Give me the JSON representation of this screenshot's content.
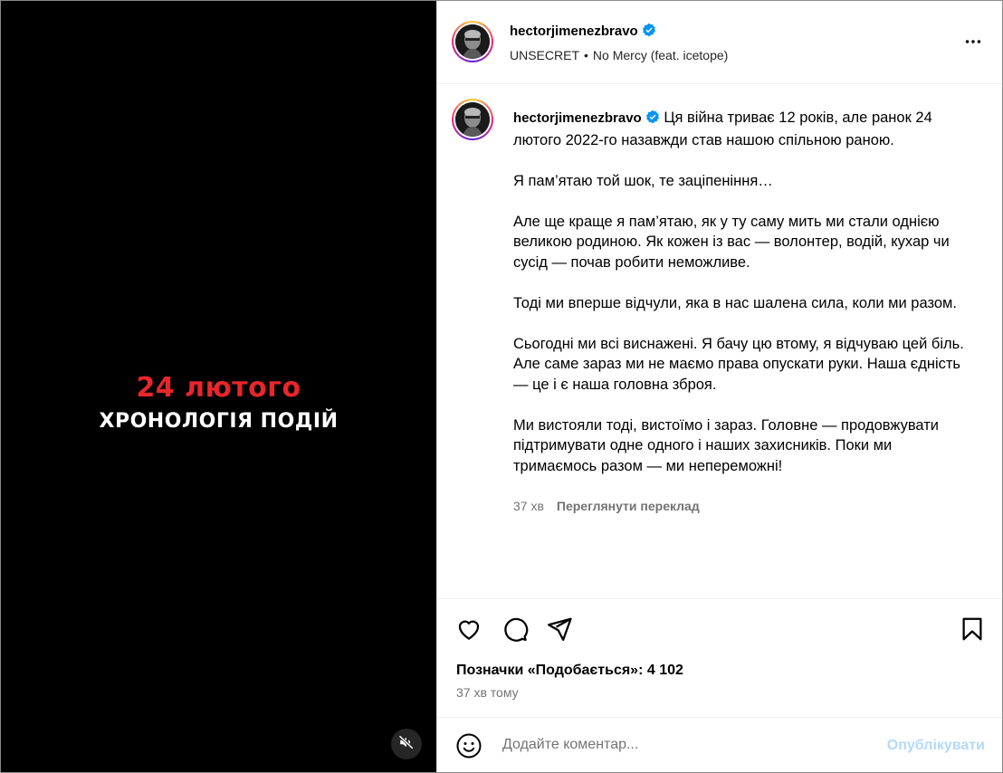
{
  "video": {
    "title_red": "24 лютого",
    "title_white": "ХРОНОЛОГІЯ ПОДІЙ"
  },
  "header": {
    "username": "hectorjimenezbravo",
    "audio_artist": "UNSECRET",
    "audio_sep": "•",
    "audio_track": "No Mercy (feat. icetope)"
  },
  "caption": {
    "username": "hectorjimenezbravo",
    "paragraphs": [
      "Ця війна триває 12 років, але ранок 24 лютого 2022-го назавжди став нашою спільною раною.",
      "Я пам’ятаю той шок, те заціпеніння…",
      "Але ще краще я пам’ятаю, як у ту саму мить ми стали однією великою родиною. Як кожен із вас — волонтер, водій, кухар чи сусід — почав робити неможливе.",
      "Тоді ми вперше відчули, яка в нас шалена сила, коли ми разом.",
      "Сьогодні ми всі виснажені. Я бачу цю втому, я відчуваю цей біль. Але саме зараз ми не маємо права опускати руки. Наша єдність — це і є наша головна зброя.",
      "Ми вистояли тоді, вистоїмо і зараз. Головне — продовжувати підтримувати одне одного і наших захисників. Поки ми тримаємось разом — ми непереможні!"
    ],
    "time": "37 хв",
    "translate": "Переглянути переклад"
  },
  "stats": {
    "likes": "Позначки «Подобається»: 4 102",
    "time_ago": "37 хв тому"
  },
  "comment": {
    "placeholder": "Додайте коментар...",
    "publish": "Опублікувати"
  },
  "colors": {
    "accent_red": "#e8262b",
    "verified_blue": "#0095f6",
    "publish_disabled": "#b3d9fb",
    "muted_text": "#737373"
  },
  "icons": [
    "mute-icon",
    "verified-icon",
    "more-icon",
    "heart-icon",
    "comment-icon",
    "share-icon",
    "bookmark-icon",
    "emoji-icon"
  ]
}
